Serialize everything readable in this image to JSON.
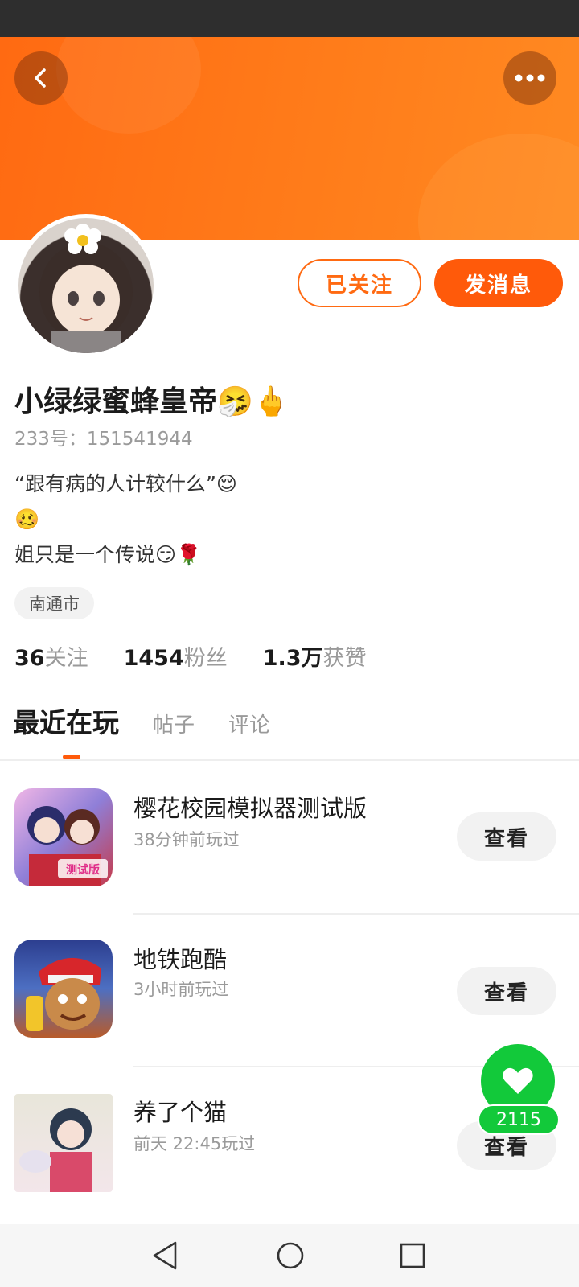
{
  "header": {
    "back_icon": "chevron-left-icon",
    "more_icon": "more-horizontal-icon"
  },
  "actions": {
    "follow_label": "已关注",
    "message_label": "发消息"
  },
  "profile": {
    "name": "小绿绿蜜蜂皇帝🤧🖕",
    "id_label": "233号：151541944",
    "bio": "“跟有病的人计较什么”😌\n🥴\n姐只是一个传说😏🌹",
    "location": "南通市"
  },
  "stats": [
    {
      "number": "36",
      "label": "关注"
    },
    {
      "number": "1454",
      "label": "粉丝"
    },
    {
      "number": "1.3万",
      "label": "获赞"
    }
  ],
  "tabs": [
    {
      "label": "最近在玩",
      "active": true
    },
    {
      "label": "帖子",
      "active": false
    },
    {
      "label": "评论",
      "active": false
    }
  ],
  "games": [
    {
      "title": "樱花校园模拟器测试版",
      "played": "38分钟前玩过",
      "button": "查看",
      "icon_text": "测试版"
    },
    {
      "title": "地铁跑酷",
      "played": "3小时前玩过",
      "button": "查看"
    },
    {
      "title": "养了个猫",
      "played": "前天 22:45玩过",
      "button": "查看"
    }
  ],
  "like": {
    "count": "2115",
    "icon": "heart-icon"
  },
  "colors": {
    "accent": "#ff5a0a",
    "banner": "#ff7a18",
    "like": "#12c93a"
  },
  "nav": {
    "icons": [
      "back-triangle-icon",
      "home-circle-icon",
      "recents-square-icon"
    ]
  }
}
